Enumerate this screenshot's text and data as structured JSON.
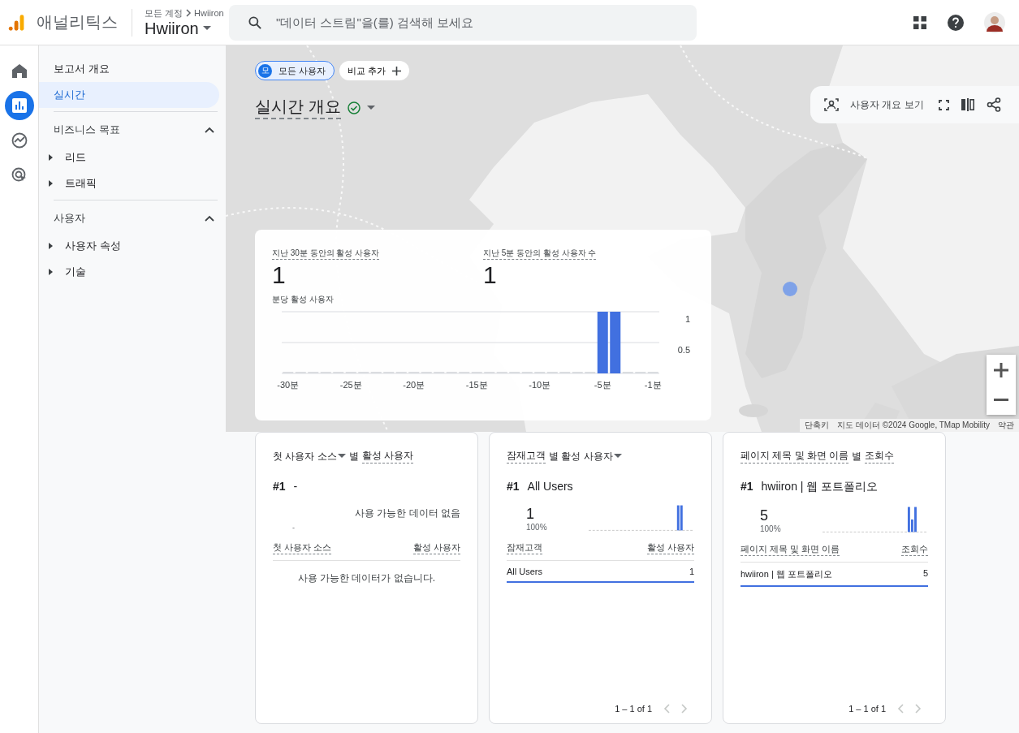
{
  "header": {
    "product": "애널리틱스",
    "breadcrumb": [
      "모든 계정",
      "Hwiiron"
    ],
    "property": "Hwiiron",
    "search": {
      "placeholder": "\"데이터 스트림\"을(를) 검색해 보세요"
    }
  },
  "rail": [
    {
      "kind": "home",
      "selected": false
    },
    {
      "kind": "reports",
      "selected": true
    },
    {
      "kind": "explore",
      "selected": false
    },
    {
      "kind": "advertising",
      "selected": false
    }
  ],
  "nav": [
    {
      "kind": "item",
      "label": "보고서 개요",
      "selected": false
    },
    {
      "kind": "item",
      "label": "실시간",
      "selected": true
    },
    {
      "kind": "section",
      "label": "비즈니스 목표",
      "expanded": true,
      "children": [
        {
          "label": "리드",
          "expanded": false
        },
        {
          "label": "트래픽",
          "expanded": false
        }
      ]
    },
    {
      "kind": "section",
      "label": "사용자",
      "expanded": true,
      "children": [
        {
          "label": "사용자 속성",
          "expanded": false
        },
        {
          "label": "기술",
          "expanded": false
        }
      ]
    }
  ],
  "map": {
    "chips": [
      {
        "kind": "segment",
        "avatar": "모",
        "label": "모든 사용자"
      },
      {
        "kind": "add",
        "label": "비교 추가"
      }
    ],
    "title": "실시간 개요",
    "toolbar": {
      "view_label": "사용자 개요 보기"
    },
    "attribution": [
      "단축키",
      "지도 데이터 ©2024 Google, TMap Mobility",
      "약관"
    ]
  },
  "realtime": {
    "metrics": [
      {
        "label": "지난 30분 동안의 활성 사용자",
        "value": "1"
      },
      {
        "label": "지난 5분 동안의 활성 사용자 수",
        "value": "1"
      }
    ],
    "chart_data": {
      "type": "bar",
      "title": "분당 활성 사용자",
      "x": [
        -30,
        -29,
        -28,
        -27,
        -26,
        -25,
        -24,
        -23,
        -22,
        -21,
        -20,
        -19,
        -18,
        -17,
        -16,
        -15,
        -14,
        -13,
        -12,
        -11,
        -10,
        -9,
        -8,
        -7,
        -6,
        -5,
        -4,
        -3,
        -2,
        -1
      ],
      "values": [
        0,
        0,
        0,
        0,
        0,
        0,
        0,
        0,
        0,
        0,
        0,
        0,
        0,
        0,
        0,
        0,
        0,
        0,
        0,
        0,
        0,
        0,
        0,
        0,
        0,
        1,
        1,
        0,
        0,
        0
      ],
      "xticks": [
        {
          "value": -30,
          "label": "-30분"
        },
        {
          "value": -25,
          "label": "-25분"
        },
        {
          "value": -20,
          "label": "-20분"
        },
        {
          "value": -15,
          "label": "-15분"
        },
        {
          "value": -10,
          "label": "-10분"
        },
        {
          "value": -5,
          "label": "-5분"
        },
        {
          "value": -1,
          "label": "-1분"
        }
      ],
      "yticks": [
        {
          "value": 0.5,
          "label": "0.5"
        },
        {
          "value": 1,
          "label": "1"
        }
      ],
      "xlim": [
        -30.5,
        -0.5
      ],
      "ylim": [
        0,
        1
      ]
    }
  },
  "cards": [
    {
      "kind": "empty",
      "title": [
        {
          "text": "첫 사용자 소스",
          "dotted": false,
          "dropdown": true
        },
        {
          "text": "별",
          "dotted": false,
          "dropdown": false
        },
        {
          "text": "활성 사용자",
          "dotted": true,
          "dropdown": false
        }
      ],
      "rank": "#1",
      "top_name": "-",
      "value": "-",
      "no_data": "사용 가능한 데이터 없음",
      "columns": [
        "첫 사용자 소스",
        "활성 사용자"
      ],
      "empty_message": "사용 가능한 데이터가 없습니다."
    },
    {
      "kind": "pair",
      "title": [
        {
          "text": "잠재고객",
          "dotted": true,
          "dropdown": false
        },
        {
          "text": "별 활성 사용자",
          "dotted": false,
          "dropdown": true
        }
      ],
      "rank": "#1",
      "top_name": "All Users",
      "value": "1",
      "share": "100%",
      "columns": [
        "잠재고객",
        "활성 사용자"
      ],
      "rows": [
        {
          "name": "All Users",
          "value": "1",
          "level": 1
        }
      ],
      "pager": "1 – 1 of 1"
    },
    {
      "kind": "triple",
      "title": [
        {
          "text": "페이지 제목 및 화면 이름",
          "dotted": true,
          "dropdown": false
        },
        {
          "text": "별",
          "dotted": false,
          "dropdown": false
        },
        {
          "text": "조회수",
          "dotted": true,
          "dropdown": false
        }
      ],
      "rank": "#1",
      "top_name": "hwiiron | 웹 포트폴리오",
      "value": "5",
      "share": "100%",
      "columns": [
        "페이지 제목 및 화면 이름",
        "조회수"
      ],
      "rows": [
        {
          "name": "hwiiron | 웹 포트폴리오",
          "value": "5",
          "level": 1
        }
      ],
      "pager": "1 – 1 of 1"
    }
  ]
}
